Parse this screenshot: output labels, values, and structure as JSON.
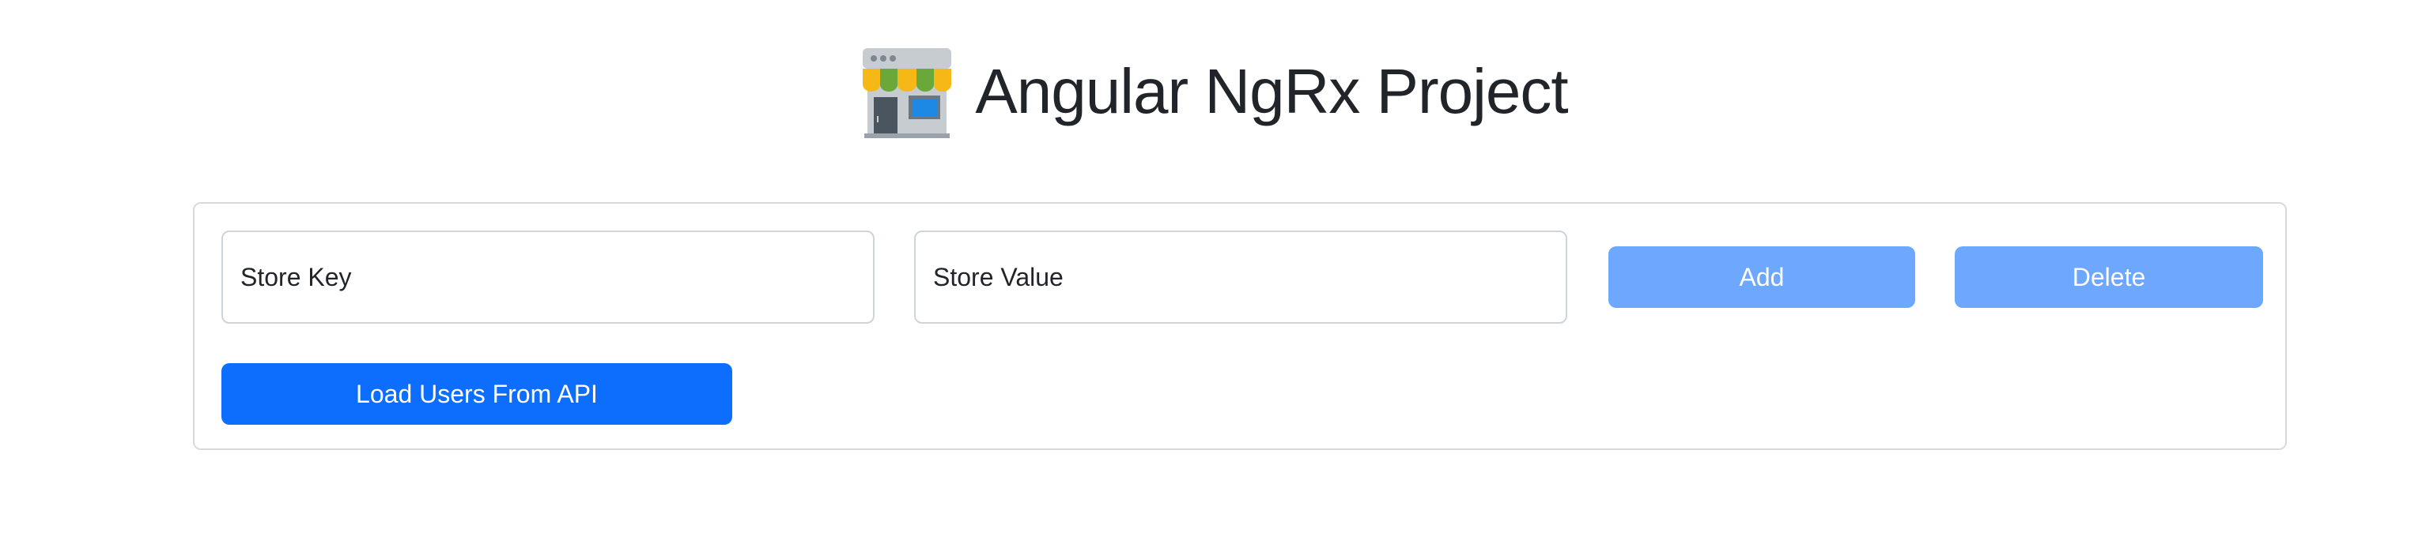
{
  "header": {
    "title": "Angular NgRx Project",
    "icon": "convenience-store-icon"
  },
  "form": {
    "key_placeholder": "Store Key",
    "value_placeholder": "Store Value",
    "add_label": "Add",
    "delete_label": "Delete",
    "load_label": "Load Users From API"
  },
  "colors": {
    "primary": "#0d6efd",
    "primary_disabled": "#6ea8fe",
    "border": "#ced4da",
    "text": "#212529"
  }
}
